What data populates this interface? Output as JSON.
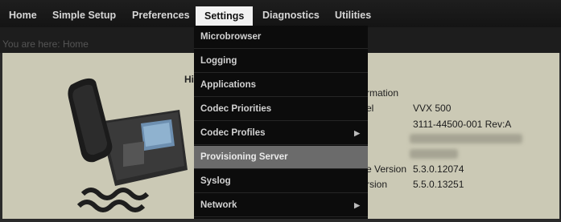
{
  "nav": {
    "items": [
      "Home",
      "Simple Setup",
      "Preferences",
      "Settings",
      "Diagnostics",
      "Utilities"
    ]
  },
  "breadcrumb": {
    "text": "You are here: Home"
  },
  "panel": {
    "title_fragment": "Hi",
    "info_heading": "rmation",
    "rows": [
      {
        "label": "el",
        "value": "VVX 500"
      },
      {
        "label": "",
        "value": "3111-44500-001 Rev:A"
      },
      {
        "label": "e Version",
        "value": "5.3.0.12074"
      },
      {
        "label": "rsion",
        "value": "5.5.0.13251"
      }
    ]
  },
  "settings_menu": {
    "items": [
      {
        "label": "Microbrowser",
        "has_submenu": false
      },
      {
        "label": "Logging",
        "has_submenu": false
      },
      {
        "label": "Applications",
        "has_submenu": false
      },
      {
        "label": "Codec Priorities",
        "has_submenu": false
      },
      {
        "label": "Codec Profiles",
        "has_submenu": true
      },
      {
        "label": "Provisioning Server",
        "has_submenu": false,
        "selected": true
      },
      {
        "label": "Syslog",
        "has_submenu": false
      },
      {
        "label": "Network",
        "has_submenu": true
      }
    ],
    "submenu_icon": "triangle-right-icon"
  },
  "colors": {
    "nav_bg": "#141414",
    "active_tab_bg": "#f2f2f2",
    "menu_bg": "#0c0c0c",
    "menu_selected_bg": "#6b6b6b",
    "content_bg": "#cbc9b5"
  }
}
